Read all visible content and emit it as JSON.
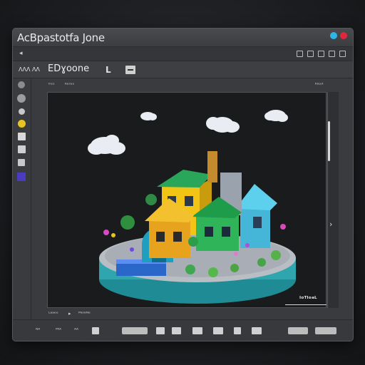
{
  "window": {
    "title": "AcBpastotfa Jone",
    "controls": [
      {
        "name": "minimize",
        "color": "#2fb6e8"
      },
      {
        "name": "close",
        "color": "#e0283a"
      }
    ]
  },
  "toolbar1": {
    "left_glyph": "◂"
  },
  "toolbar2": {
    "left_label": "ɅɅɅ ɅɅ",
    "project_name": "EDɣoone",
    "tool_glyph": "L"
  },
  "content_header": {
    "left_a": "ᴵʳᵉˢ",
    "left_b": "ᴷᵉʳᵉˢ",
    "right": "ᴷᴵᵉᵒᵗ"
  },
  "viewport": {
    "brand_label": "ᴵᵒᵀᴵᵒᵃᴸ",
    "scene": "isometric-houses-island"
  },
  "status": {
    "left": "ᴸᵃᵃᵉᵉ",
    "mid": "ᴹᵉᴵᵃᴺᵉ"
  },
  "bottombar": {
    "item1": "ᴺᴬ",
    "item2": "ᴹᴵᴬ",
    "item3": "ᴬᴬ"
  },
  "colors": {
    "accent_blue": "#2fb6e8",
    "accent_red": "#e0283a",
    "sidebar_yellow": "#e8c420",
    "sidebar_purple": "#4a3cc0"
  }
}
